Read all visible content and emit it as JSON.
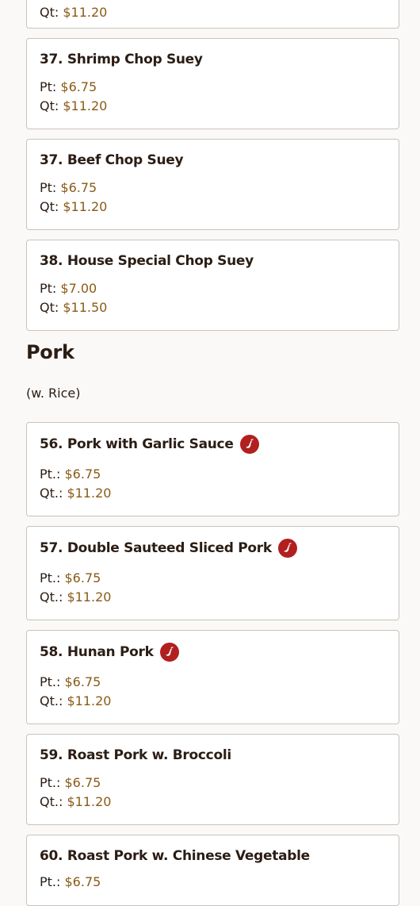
{
  "chop_suey_items": [
    {
      "name": "",
      "prices": [
        {
          "label": "Qt:",
          "value": "$11.20"
        }
      ]
    },
    {
      "name": "37. Shrimp Chop Suey",
      "prices": [
        {
          "label": "Pt:",
          "value": "$6.75"
        },
        {
          "label": "Qt:",
          "value": "$11.20"
        }
      ]
    },
    {
      "name": "37. Beef Chop Suey",
      "prices": [
        {
          "label": "Pt:",
          "value": "$6.75"
        },
        {
          "label": "Qt:",
          "value": "$11.20"
        }
      ]
    },
    {
      "name": "38. House Special Chop Suey",
      "prices": [
        {
          "label": "Pt:",
          "value": "$7.00"
        },
        {
          "label": "Qt:",
          "value": "$11.50"
        }
      ]
    }
  ],
  "pork_section": {
    "title": "Pork",
    "note": "(w. Rice)",
    "items": [
      {
        "name": "56. Pork with Garlic Sauce",
        "spicy": true,
        "icon": "chili-pepper-icon",
        "prices": [
          {
            "label": "Pt.:",
            "value": "$6.75"
          },
          {
            "label": "Qt.:",
            "value": "$11.20"
          }
        ]
      },
      {
        "name": "57. Double Sauteed Sliced Pork",
        "spicy": true,
        "icon": "chili-pepper-icon",
        "prices": [
          {
            "label": "Pt.:",
            "value": "$6.75"
          },
          {
            "label": "Qt.:",
            "value": "$11.20"
          }
        ]
      },
      {
        "name": "58. Hunan Pork",
        "spicy": true,
        "icon": "chili-pepper-icon",
        "prices": [
          {
            "label": "Pt.:",
            "value": "$6.75"
          },
          {
            "label": "Qt.:",
            "value": "$11.20"
          }
        ]
      },
      {
        "name": "59. Roast Pork w. Broccoli",
        "spicy": false,
        "prices": [
          {
            "label": "Pt.:",
            "value": "$6.75"
          },
          {
            "label": "Qt.:",
            "value": "$11.20"
          }
        ]
      },
      {
        "name": "60. Roast Pork w. Chinese Vegetable",
        "spicy": false,
        "prices": [
          {
            "label": "Pt.:",
            "value": "$6.75"
          }
        ]
      }
    ]
  },
  "colors": {
    "price": "#8a5a17",
    "spicy_badge": "#b21f1f",
    "text": "#2b1d14",
    "border": "#c9c3bd"
  }
}
